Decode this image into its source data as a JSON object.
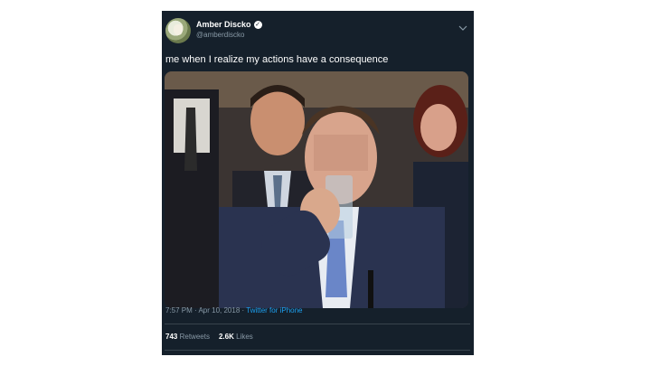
{
  "user": {
    "name": "Amber Discko",
    "verified_icon": "verified-check-icon",
    "handle": "@amberdiscko"
  },
  "tweet": {
    "text": "me when I realize my actions have a consequence",
    "timestamp": "7:57 PM · Apr 10, 2018 · ",
    "source": "Twitter for iPhone"
  },
  "stats": {
    "retweets_count": "743",
    "retweets_label": "Retweets",
    "likes_count": "2.6K",
    "likes_label": "Likes"
  },
  "colors": {
    "background": "#15202b",
    "secondary_text": "#8899a6",
    "link": "#1da1f2",
    "divider": "#38444d"
  }
}
